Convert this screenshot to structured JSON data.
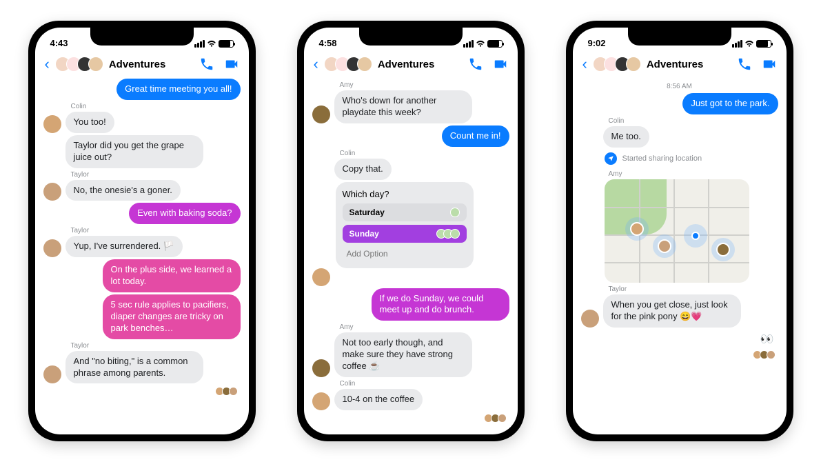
{
  "common": {
    "chat_title": "Adventures"
  },
  "phone1": {
    "time": "4:43",
    "m1": "Great time meeting you all!",
    "s1": "Colin",
    "m2": "You too!",
    "m3": "Taylor did you get the grape juice out?",
    "s2": "Taylor",
    "m4": "No, the onesie's a goner.",
    "m5": "Even with baking soda?",
    "s3": "Taylor",
    "m6": "Yup, I've surrendered. 🏳️",
    "m7": "On the plus side, we learned a lot today.",
    "m8": "5 sec rule applies to pacifiers, diaper changes are tricky on park benches…",
    "s4": "Taylor",
    "m9": "And \"no biting,\" is a common phrase among parents."
  },
  "phone2": {
    "time": "4:58",
    "s1": "Amy",
    "m1": "Who's down for another playdate this week?",
    "m2": "Count me in!",
    "s2": "Colin",
    "m3": "Copy that.",
    "poll_q": "Which day?",
    "poll_sat": "Saturday",
    "poll_sun": "Sunday",
    "poll_add": "Add Option",
    "m4": "If we do Sunday, we could meet up and do brunch.",
    "s3": "Amy",
    "m5": "Not too early though, and make sure they have strong coffee ☕",
    "s4": "Colin",
    "m6": "10-4 on the coffee"
  },
  "phone3": {
    "time": "9:02",
    "ts": "8:56 AM",
    "m1": "Just got to the park.",
    "s1": "Colin",
    "m2": "Me too.",
    "loc": "Started sharing location",
    "s2": "Amy",
    "s3": "Taylor",
    "m3": "When you get close, just look for the pink pony 😄💗",
    "react": "👀"
  }
}
